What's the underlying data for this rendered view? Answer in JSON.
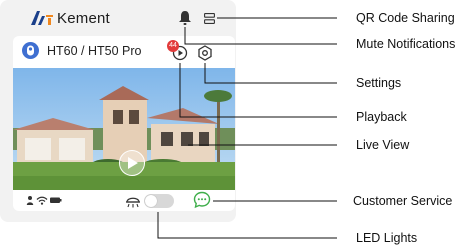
{
  "app": {
    "brand": "Kement",
    "device_name": "HT60 / HT50 Pro",
    "playback_badge": "44"
  },
  "icons": {
    "logo": "kement-logo",
    "mute": "bell-icon",
    "qr_sharing": "qr-sharing-icon",
    "device": "camera-device-icon",
    "playback": "playback-icon",
    "settings": "settings-icon",
    "play": "play-icon",
    "status": [
      "person-icon",
      "wifi-icon",
      "battery-icon"
    ],
    "led": "led-light-icon",
    "customer_service": "chat-bubble-icon"
  },
  "led_lights": {
    "enabled": false
  },
  "callouts": {
    "qr_code_sharing": "QR Code Sharing",
    "mute_notifications": "Mute Notifications",
    "settings": "Settings",
    "playback": "Playback",
    "live_view": "Live View",
    "customer_service": "Customer Service",
    "led_lights": "LED Lights"
  },
  "colors": {
    "accent_blue": "#3f6fd1",
    "logo_orange": "#f0871e",
    "badge_red": "#e23b3b",
    "service_green": "#3fae4b"
  }
}
